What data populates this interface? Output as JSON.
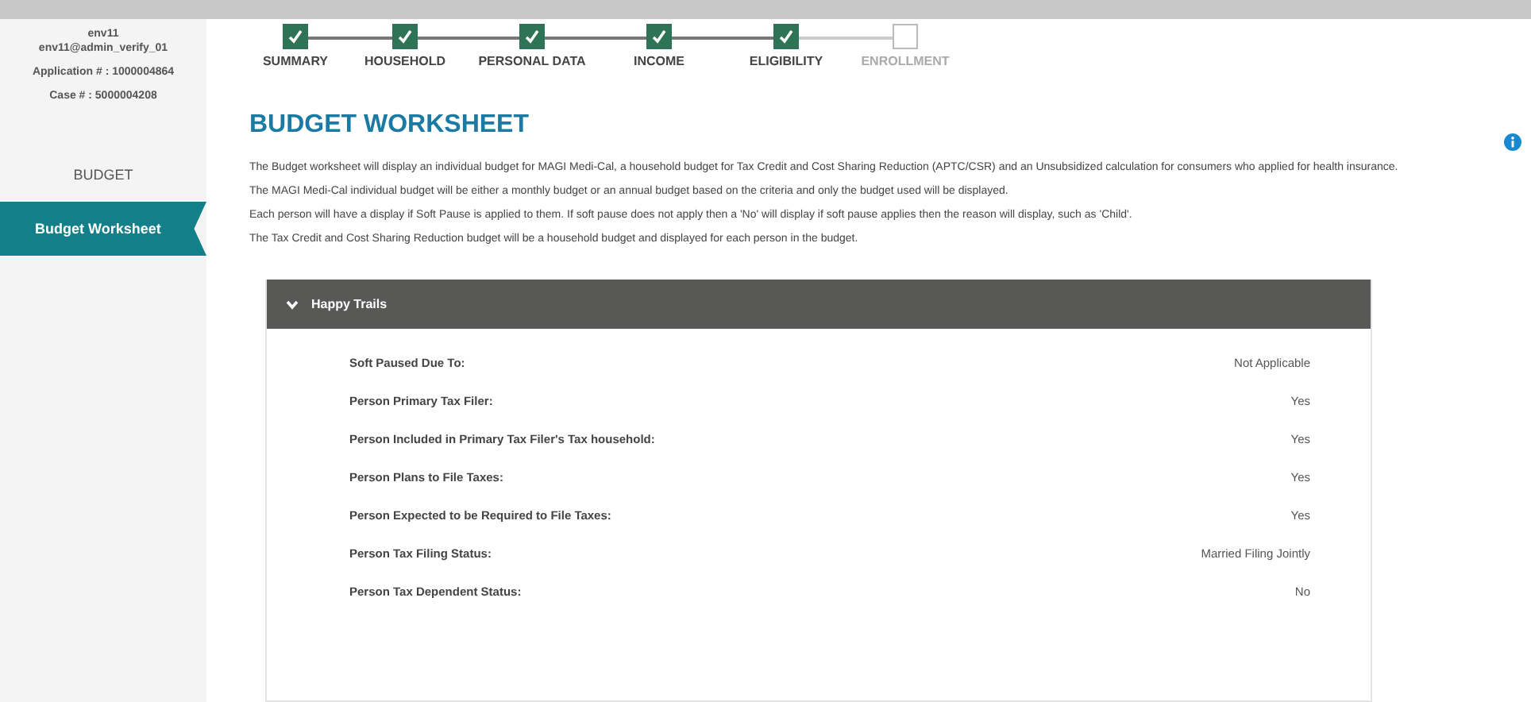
{
  "user": {
    "env": "env11",
    "login": "env11@admin_verify_01",
    "application": "Application # : 1000004864",
    "case": "Case # : 5000004208"
  },
  "nav": [
    {
      "label": "BUDGET",
      "selected": false
    },
    {
      "label": "Budget Worksheet",
      "selected": true
    }
  ],
  "steps": [
    {
      "label": "SUMMARY",
      "done": true
    },
    {
      "label": "HOUSEHOLD",
      "done": true
    },
    {
      "label": "PERSONAL DATA",
      "done": true
    },
    {
      "label": "INCOME",
      "done": true
    },
    {
      "label": "ELIGIBILITY",
      "done": true
    },
    {
      "label": "ENROLLMENT",
      "done": false
    }
  ],
  "title": "BUDGET WORKSHEET",
  "paragraphs": [
    "The Budget worksheet will display an individual budget for MAGI Medi-Cal, a household budget for Tax Credit and Cost Sharing Reduction (APTC/CSR) and an Unsubsidized calculation for consumers who applied for health insurance.",
    "The MAGI Medi-Cal individual budget will be either a monthly budget or an annual budget based on the criteria and only the budget used will be displayed.",
    "Each person will have a display if Soft Pause is applied to them. If soft pause does not apply then a 'No' will display if soft pause applies then the reason will display, such as 'Child'.",
    "The Tax Credit and Cost Sharing Reduction budget will be a household budget and displayed for each person in the budget."
  ],
  "panel": {
    "title": "Happy Trails",
    "expanded": true,
    "rows": [
      {
        "label": "Soft Paused Due To:",
        "value": "Not Applicable"
      },
      {
        "label": "Person Primary Tax Filer:",
        "value": "Yes"
      },
      {
        "label": "Person Included in Primary Tax Filer's Tax household:",
        "value": "Yes"
      },
      {
        "label": "Person Plans to File Taxes:",
        "value": "Yes"
      },
      {
        "label": "Person Expected to be Required to File Taxes:",
        "value": "Yes"
      },
      {
        "label": "Person Tax Filing Status:",
        "value": "Married Filing Jointly"
      },
      {
        "label": "Person Tax Dependent Status:",
        "value": "No"
      }
    ]
  }
}
